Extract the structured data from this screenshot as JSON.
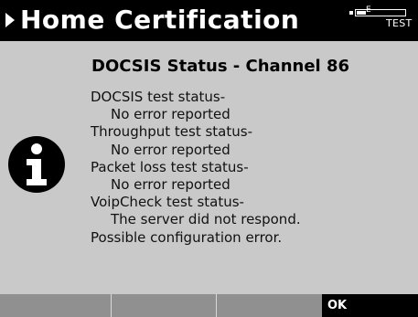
{
  "header": {
    "title": "Home Certification",
    "battery_label": "E",
    "mode_label": "TEST"
  },
  "info_icon": "info-icon",
  "status": {
    "title": "DOCSIS Status - Channel 86",
    "lines": [
      {
        "text": "DOCSIS test status-",
        "indent": false
      },
      {
        "text": "No error reported",
        "indent": true
      },
      {
        "text": "Throughput test status-",
        "indent": false
      },
      {
        "text": "No error reported",
        "indent": true
      },
      {
        "text": "Packet loss test status-",
        "indent": false
      },
      {
        "text": "No error reported",
        "indent": true
      },
      {
        "text": "VoipCheck test status-",
        "indent": false
      },
      {
        "text": "The server did not respond.",
        "indent": true
      },
      {
        "text": "Possible configuration error.",
        "indent": false
      }
    ]
  },
  "softkeys": [
    "",
    "",
    "",
    "OK"
  ]
}
